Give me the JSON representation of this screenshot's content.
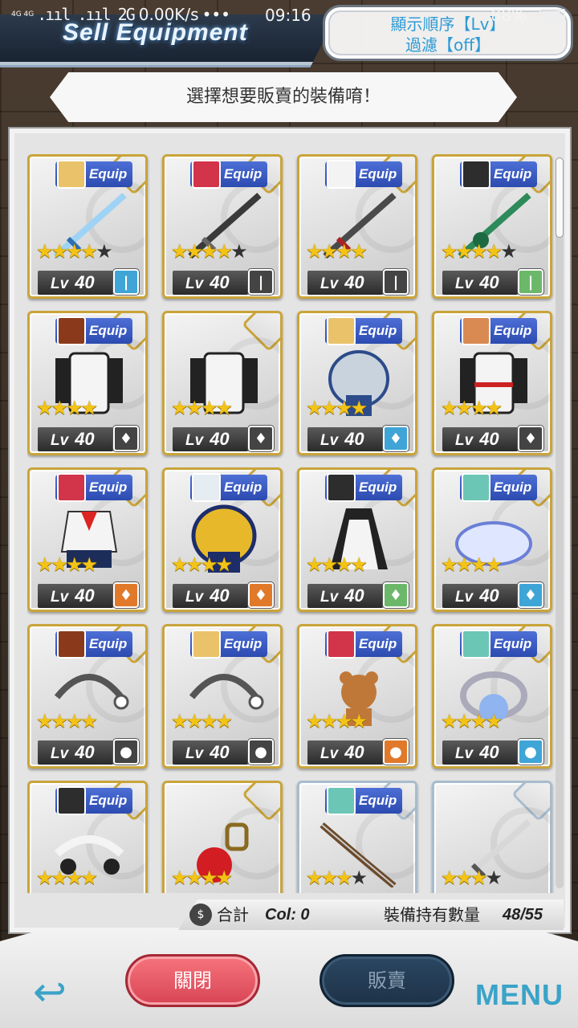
{
  "status_bar": {
    "network": "4G 4G",
    "signal": ".ııl .ııl 2G",
    "speed": "0.00K/s",
    "dots": "•••",
    "time": "09:16",
    "battery": "88%"
  },
  "header": {
    "title": "Sell Equipment",
    "sort_line1": "顯示順序【Lv】",
    "sort_line2": "過濾【off】"
  },
  "prompt": "選擇想要販賣的裝備唷！",
  "colors": {
    "gold_frame": "#c9a43a",
    "silver_frame": "#a8bccd",
    "close_button": "#e05563",
    "sell_button": "#223a52",
    "accent": "#3aa3c8"
  },
  "cards": [
    {
      "equip": "Equip",
      "lv": "Lv",
      "lv_num": "40",
      "stars": 4,
      "max": 5,
      "type": "sword-icon",
      "badge_color": "#3fa5d6",
      "avatar": "#e9c26a",
      "art": "sword-blue",
      "frame": "gold"
    },
    {
      "equip": "Equip",
      "lv": "Lv",
      "lv_num": "40",
      "stars": 4,
      "max": 5,
      "type": "sword-icon",
      "badge_color": "#444444",
      "avatar": "#d2344a",
      "art": "sword-dark",
      "frame": "gold"
    },
    {
      "equip": "Equip",
      "lv": "Lv",
      "lv_num": "40",
      "stars": 4,
      "max": 4,
      "type": "sword-icon",
      "badge_color": "#444444",
      "avatar": "#f3f3f3",
      "art": "sword-red",
      "frame": "gold"
    },
    {
      "equip": "Equip",
      "lv": "Lv",
      "lv_num": "40",
      "stars": 4,
      "max": 5,
      "type": "sword-icon",
      "badge_color": "#6cb86a",
      "avatar": "#2d2d2d",
      "art": "sword-green",
      "frame": "gold"
    },
    {
      "equip": "Equip",
      "lv": "Lv",
      "lv_num": "40",
      "stars": 4,
      "max": 4,
      "type": "armor-icon",
      "badge_color": "#444444",
      "avatar": "#8a3a1a",
      "art": "coat-white",
      "frame": "gold"
    },
    {
      "equip": "",
      "lv": "Lv",
      "lv_num": "40",
      "stars": 4,
      "max": 4,
      "type": "armor-icon",
      "badge_color": "#444444",
      "avatar": "",
      "art": "coat-white",
      "frame": "gold"
    },
    {
      "equip": "Equip",
      "lv": "Lv",
      "lv_num": "40",
      "stars": 4,
      "max": 4,
      "type": "armor-icon",
      "badge_color": "#3fa5d6",
      "avatar": "#e9c26a",
      "art": "armor-blue",
      "frame": "gold"
    },
    {
      "equip": "Equip",
      "lv": "Lv",
      "lv_num": "40",
      "stars": 4,
      "max": 4,
      "type": "armor-icon",
      "badge_color": "#444444",
      "avatar": "#d98a52",
      "art": "coat-red",
      "frame": "gold"
    },
    {
      "equip": "Equip",
      "lv": "Lv",
      "lv_num": "40",
      "stars": 4,
      "max": 4,
      "type": "armor-icon",
      "badge_color": "#e07a2a",
      "avatar": "#d2344a",
      "art": "uniform",
      "frame": "gold"
    },
    {
      "equip": "Equip",
      "lv": "Lv",
      "lv_num": "40",
      "stars": 4,
      "max": 4,
      "type": "armor-icon",
      "badge_color": "#e07a2a",
      "avatar": "#e6edf2",
      "art": "armor-gold",
      "frame": "gold"
    },
    {
      "equip": "Equip",
      "lv": "Lv",
      "lv_num": "40",
      "stars": 4,
      "max": 4,
      "type": "armor-icon",
      "badge_color": "#6cb86a",
      "avatar": "#2d2d2d",
      "art": "maid-dress",
      "frame": "gold"
    },
    {
      "equip": "Equip",
      "lv": "Lv",
      "lv_num": "40",
      "stars": 4,
      "max": 4,
      "type": "armor-icon",
      "badge_color": "#3fa5d6",
      "avatar": "#6cc6b6",
      "art": "skirt-blue",
      "frame": "gold"
    },
    {
      "equip": "Equip",
      "lv": "Lv",
      "lv_num": "40",
      "stars": 4,
      "max": 4,
      "type": "accessory-icon",
      "badge_color": "#444444",
      "avatar": "#8a3a1a",
      "art": "headband",
      "frame": "gold"
    },
    {
      "equip": "Equip",
      "lv": "Lv",
      "lv_num": "40",
      "stars": 4,
      "max": 4,
      "type": "accessory-icon",
      "badge_color": "#444444",
      "avatar": "#e9c26a",
      "art": "headband",
      "frame": "gold"
    },
    {
      "equip": "Equip",
      "lv": "Lv",
      "lv_num": "40",
      "stars": 4,
      "max": 4,
      "type": "accessory-icon",
      "badge_color": "#e07a2a",
      "avatar": "#d2344a",
      "art": "bear",
      "frame": "gold"
    },
    {
      "equip": "Equip",
      "lv": "Lv",
      "lv_num": "40",
      "stars": 4,
      "max": 4,
      "type": "accessory-icon",
      "badge_color": "#3fa5d6",
      "avatar": "#6cc6b6",
      "art": "ring",
      "frame": "gold"
    },
    {
      "equip": "Equip",
      "lv": "",
      "lv_num": "",
      "stars": 4,
      "max": 4,
      "type": "",
      "badge_color": "",
      "avatar": "#2d2d2d",
      "art": "maid-headband",
      "frame": "gold"
    },
    {
      "equip": "",
      "lv": "",
      "lv_num": "",
      "stars": 4,
      "max": 4,
      "type": "",
      "badge_color": "",
      "avatar": "",
      "art": "apple",
      "frame": "gold"
    },
    {
      "equip": "Equip",
      "lv": "",
      "lv_num": "",
      "stars": 3,
      "max": 4,
      "type": "",
      "badge_color": "",
      "avatar": "#6cc6b6",
      "art": "bow",
      "frame": "silver"
    },
    {
      "equip": "",
      "lv": "",
      "lv_num": "",
      "stars": 3,
      "max": 4,
      "type": "",
      "badge_color": "",
      "avatar": "",
      "art": "sword-silver",
      "frame": "silver"
    }
  ],
  "scroll": {
    "thumb_fraction": 0.11
  },
  "totals": {
    "coin_icon_glyph": "$",
    "sum_label": "合計",
    "col_text": "Col: 0",
    "owned_label": "裝備持有數量",
    "owned_value": "48/55"
  },
  "buttons": {
    "back": "↩",
    "close": "關閉",
    "sell": "販賣",
    "menu": "MENU"
  }
}
